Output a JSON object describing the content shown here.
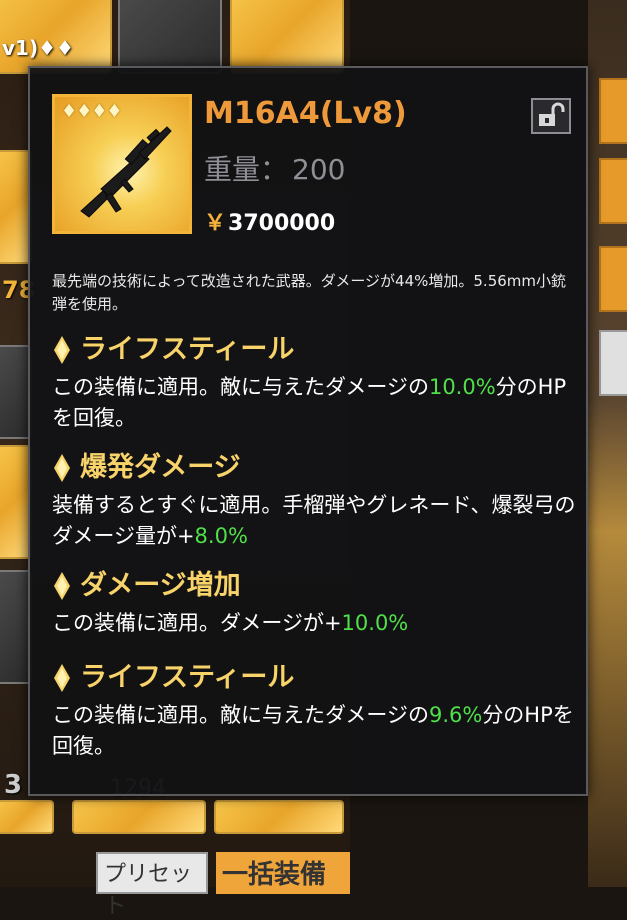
{
  "item": {
    "name": "M16A4(Lv8)",
    "weight_label": "重量：",
    "weight_value": "200",
    "currency_symbol": "￥",
    "price": "3700000",
    "rarity_icons": "♦♦♦♦",
    "description": "最先端の技術によって改造された武器。ダメージが44%増加。5.56mm小銃弾を使用。"
  },
  "skills": [
    {
      "title": "ライフスティール",
      "desc_prefix": "この装備に適用。敵に与えたダメージの",
      "desc_value": "10.0%",
      "desc_suffix": "分のHPを回復。"
    },
    {
      "title": "爆発ダメージ",
      "desc_prefix": "装備するとすぐに適用。手榴弾やグレネード、爆裂弓のダメージ量が+",
      "desc_value": "8.0%",
      "desc_suffix": ""
    },
    {
      "title": "ダメージ増加",
      "desc_prefix": "この装備に適用。ダメージが+",
      "desc_value": "10.0%",
      "desc_suffix": ""
    },
    {
      "title": "ライフスティール",
      "desc_prefix": "この装備に適用。敵に与えたダメージの",
      "desc_value": "9.6%",
      "desc_suffix": "分のHPを回復。"
    }
  ],
  "background": {
    "fragment_top_left": "v1)♦♦",
    "fragment_number": "78",
    "fragment_bottom": "3",
    "fragment_bottom_count": "1294",
    "preset_button": "プリセット",
    "equip_all_button": "一括装備"
  },
  "icons": {
    "lock": "unlocked-padlock-icon",
    "skill_bullet": "diamond-icon"
  },
  "colors": {
    "item_name": "#ee9a3a",
    "skill_title": "#f7d36a",
    "highlight": "#4fe04a",
    "panel_bg": "#121214"
  }
}
